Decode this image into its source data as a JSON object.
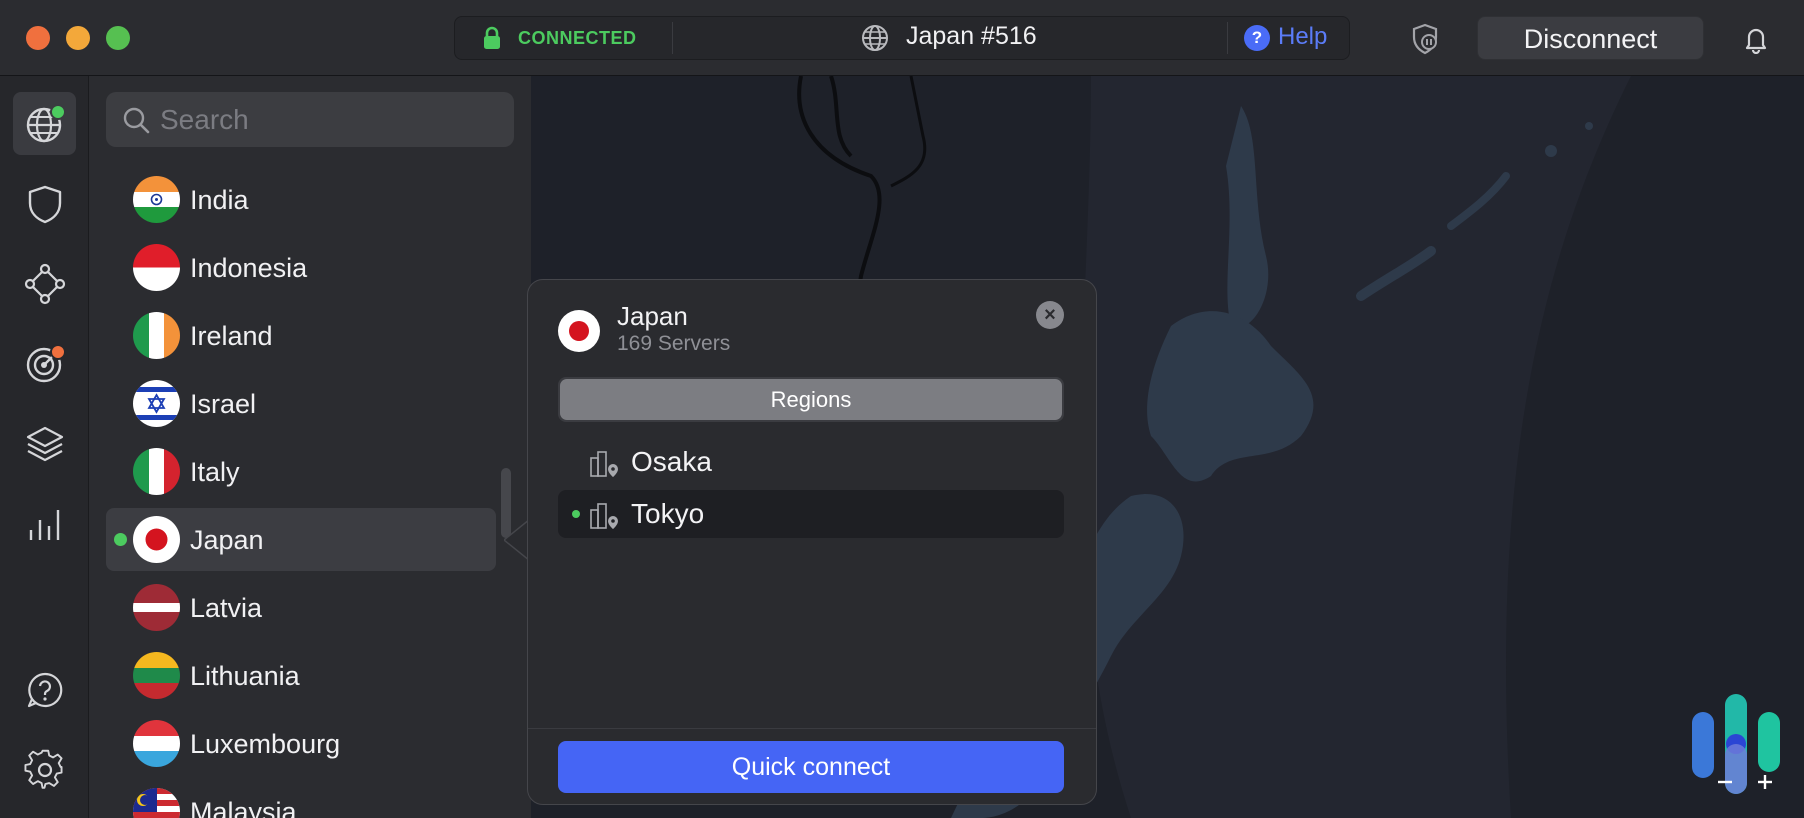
{
  "titlebar": {
    "status": "CONNECTED",
    "server": "Japan #516",
    "help": "Help",
    "disconnect": "Disconnect"
  },
  "sidebar": {
    "items": [
      {
        "icon": "globe-icon",
        "active": true
      },
      {
        "icon": "shield-icon"
      },
      {
        "icon": "meshnet-icon"
      },
      {
        "icon": "threat-radar-icon"
      },
      {
        "icon": "layers-icon"
      },
      {
        "icon": "stats-icon"
      }
    ],
    "bottom": [
      {
        "icon": "help-circle-icon"
      },
      {
        "icon": "gear-icon"
      }
    ]
  },
  "search": {
    "placeholder": "Search"
  },
  "countries": [
    {
      "name": "India"
    },
    {
      "name": "Indonesia"
    },
    {
      "name": "Ireland"
    },
    {
      "name": "Israel"
    },
    {
      "name": "Italy"
    },
    {
      "name": "Japan",
      "selected": true
    },
    {
      "name": "Latvia"
    },
    {
      "name": "Lithuania"
    },
    {
      "name": "Luxembourg"
    },
    {
      "name": "Malaysia"
    }
  ],
  "popover": {
    "title": "Japan",
    "subtitle": "169 Servers",
    "segment": "Regions",
    "regions": [
      {
        "name": "Osaka"
      },
      {
        "name": "Tokyo",
        "selected": true
      }
    ],
    "quick_connect": "Quick connect"
  },
  "colors": {
    "accent": "#4565f5",
    "connected": "#4ccb5f",
    "background": "#1e2027"
  }
}
